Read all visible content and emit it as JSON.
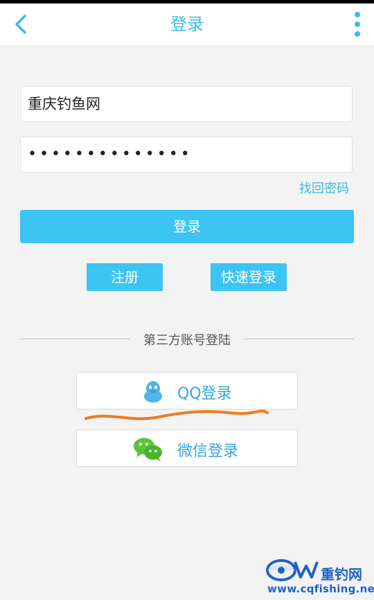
{
  "header": {
    "title": "登录",
    "back_icon": "chevron-left-icon",
    "menu_icon": "vertical-dots-icon"
  },
  "form": {
    "username_value": "重庆钓鱼网",
    "password_value": "••••••••••••••",
    "forgot_label": "找回密码",
    "login_label": "登录",
    "register_label": "注册",
    "quick_login_label": "快速登录"
  },
  "third_party": {
    "divider_label": "第三方账号登陆",
    "qq_label": "QQ登录",
    "wechat_label": "微信登录"
  },
  "watermark": {
    "name": "重钓网",
    "url": "www.cqfishing.net"
  },
  "colors": {
    "accent": "#3dbbe9",
    "button": "#3cc4f3",
    "scribble": "#f07a1e",
    "wechat": "#5bc53a"
  }
}
